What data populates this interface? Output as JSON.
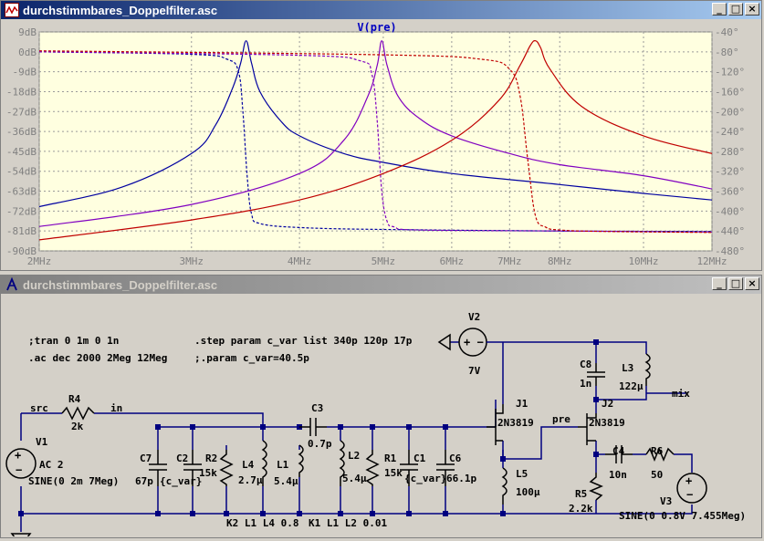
{
  "plot_window": {
    "title": "durchstimmbares_Doppelfilter.asc",
    "trace_label": "V(pre)",
    "colors": {
      "background": "#ffffe0",
      "grid": "#9a9a9a",
      "axis_text": "#808080",
      "label": "#0000c0"
    }
  },
  "schematic_window": {
    "title": "durchstimmbares_Doppelfilter.asc",
    "directives": [
      ";tran 0 1m 0 1n",
      ".ac dec 2000 2Meg 12Meg",
      ".step param c_var list 340p 120p 17p",
      ";.param c_var=40.5p"
    ],
    "labels": {
      "src": "src",
      "in": "in",
      "pre": "pre",
      "mix": "mix",
      "V1": "V1",
      "V1_v": "AC 2",
      "V1_sine": "SINE(0 2m 7Meg)",
      "R4": "R4",
      "R4_v": "2k",
      "C7": "C7",
      "C7_v": "67p",
      "C2": "C2",
      "C2_v": "{c_var}",
      "R2": "R2",
      "R2_v": "15k",
      "L4": "L4",
      "L4_v": "2.7µ",
      "L1": "L1",
      "L1_v": "5.4µ",
      "C3": "C3",
      "C3_v": "0.7p",
      "L2": "L2",
      "L2_v": "5.4µ",
      "R1": "R1",
      "R1_v": "15k",
      "C1": "C1",
      "C1_v": "{c_var}",
      "C6": "C6",
      "C6_v": "66.1p",
      "K2": "K2 L1 L4 0.8",
      "K1": "K1 L1 L2 0.01",
      "V2": "V2",
      "V2_v": "7V",
      "J1": "J1",
      "J1_v": "2N3819",
      "L5": "L5",
      "L5_v": "100µ",
      "J2": "J2",
      "J2_v": "2N3819",
      "C8": "C8",
      "C8_v": "1n",
      "L3": "L3",
      "L3_v": "122µ",
      "C4": "C4",
      "C4_v": "10n",
      "R6": "R6",
      "R6_v": "50",
      "R5": "R5",
      "R5_v": "2.2k",
      "V3": "V3",
      "V3_sine": "SINE(0 0.8V 7.455Meg)"
    }
  },
  "chart_data": {
    "type": "line",
    "title": "V(pre)",
    "x_scale": "log",
    "xlim": [
      2,
      12
    ],
    "x_unit": "MHz",
    "x_ticks": [
      "2MHz",
      "3MHz",
      "4MHz",
      "5MHz",
      "6MHz",
      "7MHz",
      "8MHz",
      "10MHz",
      "12MHz"
    ],
    "x_tick_values": [
      2,
      3,
      4,
      5,
      6,
      7,
      8,
      10,
      12
    ],
    "ylim": [
      -90,
      9
    ],
    "y_ticks": [
      "9dB",
      "0dB",
      "-9dB",
      "-18dB",
      "-27dB",
      "-36dB",
      "-45dB",
      "-54dB",
      "-63dB",
      "-72dB",
      "-81dB",
      "-90dB"
    ],
    "y_tick_values": [
      9,
      0,
      -9,
      -18,
      -27,
      -36,
      -45,
      -54,
      -63,
      -72,
      -81,
      -90
    ],
    "y2lim": [
      -480,
      -40
    ],
    "y2_ticks": [
      "-40°",
      "-80°",
      "-120°",
      "-160°",
      "-200°",
      "-240°",
      "-280°",
      "-320°",
      "-360°",
      "-400°",
      "-440°",
      "-480°"
    ],
    "y2_tick_values": [
      -40,
      -80,
      -120,
      -160,
      -200,
      -240,
      -280,
      -320,
      -360,
      -400,
      -440,
      -480
    ],
    "grid": true,
    "series": [
      {
        "color": "#0000a0",
        "kind": "magnitude",
        "x": [
          2.0,
          2.5,
          3.0,
          3.2,
          3.35,
          3.42,
          3.47,
          3.52,
          3.6,
          3.8,
          4.0,
          4.5,
          5.0,
          6.0,
          8.0,
          10.0,
          12.0
        ],
        "y": [
          -70,
          -61,
          -46,
          -33,
          -16,
          -5,
          5,
          -5,
          -18,
          -31,
          -38,
          -46,
          -50,
          -55,
          -60,
          -64,
          -67
        ]
      },
      {
        "color": "#0000a0",
        "kind": "phase",
        "x": [
          2.0,
          3.0,
          3.3,
          3.4,
          3.44,
          3.48,
          3.52,
          3.6,
          4.0,
          5.0,
          8.0,
          12.0
        ],
        "y": [
          -80,
          -85,
          -95,
          -120,
          -200,
          -330,
          -405,
          -425,
          -433,
          -437,
          -440,
          -441
        ]
      },
      {
        "color": "#8000c0",
        "kind": "magnitude",
        "x": [
          2.0,
          3.0,
          4.0,
          4.5,
          4.8,
          4.92,
          4.98,
          5.05,
          5.2,
          5.5,
          6.0,
          7.0,
          8.0,
          10.0,
          12.0
        ],
        "y": [
          -79,
          -69,
          -55,
          -40,
          -20,
          -6,
          5,
          -6,
          -20,
          -30,
          -38,
          -46,
          -51,
          -56,
          -62
        ]
      },
      {
        "color": "#8000c0",
        "kind": "phase",
        "x": [
          2.0,
          4.0,
          4.7,
          4.85,
          4.92,
          4.98,
          5.05,
          5.15,
          5.5,
          8.0,
          12.0
        ],
        "y": [
          -80,
          -87,
          -98,
          -125,
          -220,
          -360,
          -420,
          -432,
          -438,
          -440,
          -442
        ]
      },
      {
        "color": "#c00000",
        "kind": "magnitude",
        "x": [
          2.0,
          3.0,
          4.0,
          5.0,
          6.0,
          6.8,
          7.2,
          7.4,
          7.5,
          7.6,
          7.8,
          8.5,
          10.0,
          12.0
        ],
        "y": [
          -85,
          -76,
          -67,
          -55,
          -40,
          -22,
          -6,
          3,
          5,
          2,
          -8,
          -25,
          -38,
          -46
        ]
      },
      {
        "color": "#c00000",
        "kind": "phase",
        "x": [
          2.0,
          5.0,
          6.5,
          7.0,
          7.2,
          7.35,
          7.5,
          7.7,
          8.0,
          9.0,
          12.0
        ],
        "y": [
          -78,
          -86,
          -95,
          -115,
          -170,
          -300,
          -410,
          -432,
          -438,
          -441,
          -443
        ]
      }
    ]
  }
}
